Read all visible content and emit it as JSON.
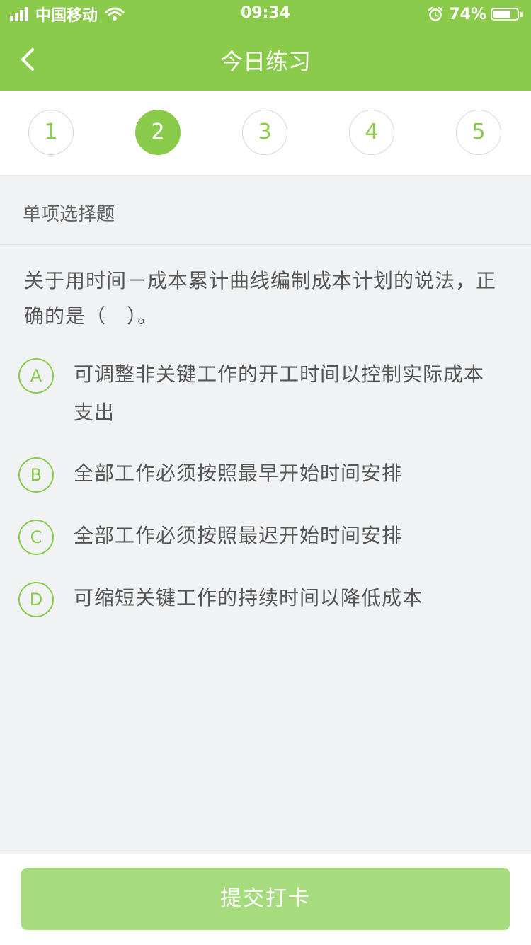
{
  "status_bar": {
    "carrier": "中国移动",
    "time": "09:34",
    "battery": "74%",
    "battery_level": 0.74,
    "icons": [
      "signal-icon",
      "wifi-icon",
      "alarm-icon",
      "battery-icon"
    ]
  },
  "nav": {
    "back_icon": "chevron-left-icon",
    "title": "今日练习"
  },
  "question_numbers": {
    "items": [
      "1",
      "2",
      "3",
      "4",
      "5"
    ],
    "active": "2"
  },
  "question": {
    "type_label": "单项选择题",
    "stem": "关于用时间－成本累计曲线编制成本计划的说法，正确的是（　）。",
    "options": [
      {
        "letter": "A",
        "text": "可调整非关键工作的开工时间以控制实际成本支出"
      },
      {
        "letter": "B",
        "text": "全部工作必须按照最早开始时间安排"
      },
      {
        "letter": "C",
        "text": "全部工作必须按照最迟开始时间安排"
      },
      {
        "letter": "D",
        "text": "可缩短关键工作的持续时间以降低成本"
      }
    ]
  },
  "footer": {
    "submit_label": "提交打卡"
  },
  "colors": {
    "primary": "#8bcb4c",
    "button_disabled": "#a6dc7d",
    "background": "#f1f2f4",
    "text": "#555555"
  }
}
